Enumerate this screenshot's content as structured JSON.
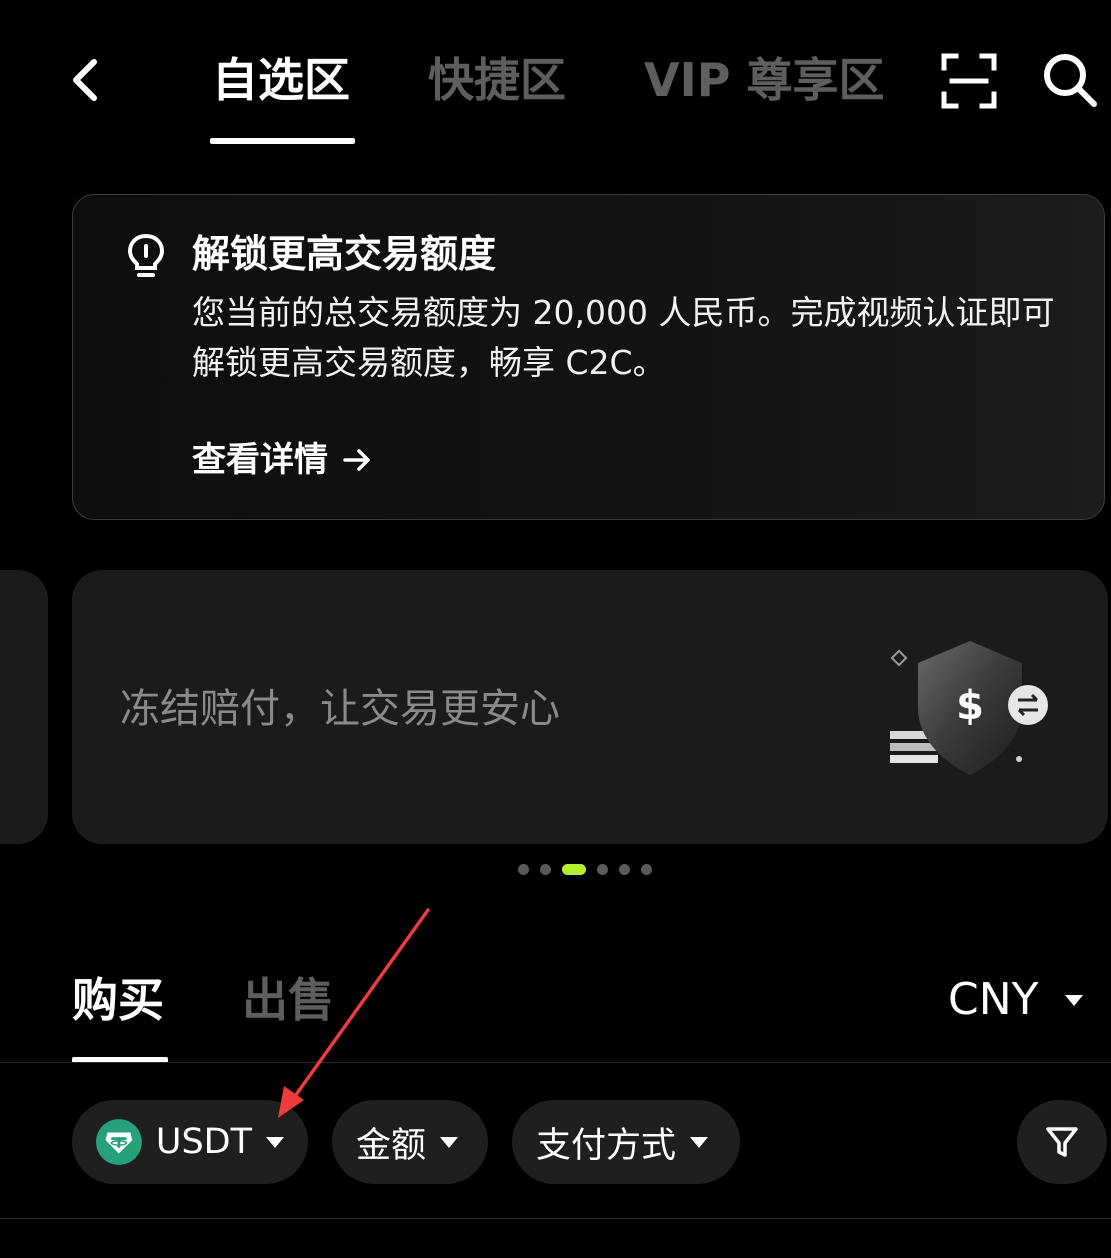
{
  "nav": {
    "tabs": [
      "自选区",
      "快捷区",
      "VIP 尊享区"
    ],
    "active_tab": "自选区",
    "icons": [
      "back-icon",
      "scan-icon",
      "search-icon"
    ]
  },
  "unlock_card": {
    "title": "解锁更高交易额度",
    "description": "您当前的总交易额度为 20,000 人民币。完成视频认证即可解锁更高交易额度，畅享 C2C。",
    "link_label": "查看详情",
    "icons": [
      "lightbulb-icon",
      "arrow-right-icon"
    ]
  },
  "banner": {
    "text": "冻结赔付，让交易更安心",
    "dot_count": 6,
    "active_dot": 2,
    "active_dot_color": "#b4ee2e"
  },
  "trade": {
    "tabs": [
      "购买",
      "出售"
    ],
    "active_tab": "购买",
    "currency": "CNY"
  },
  "filters": {
    "coin": "USDT",
    "amount": "金额",
    "payment": "支付方式",
    "coin_icon_color": "#26a17b"
  }
}
